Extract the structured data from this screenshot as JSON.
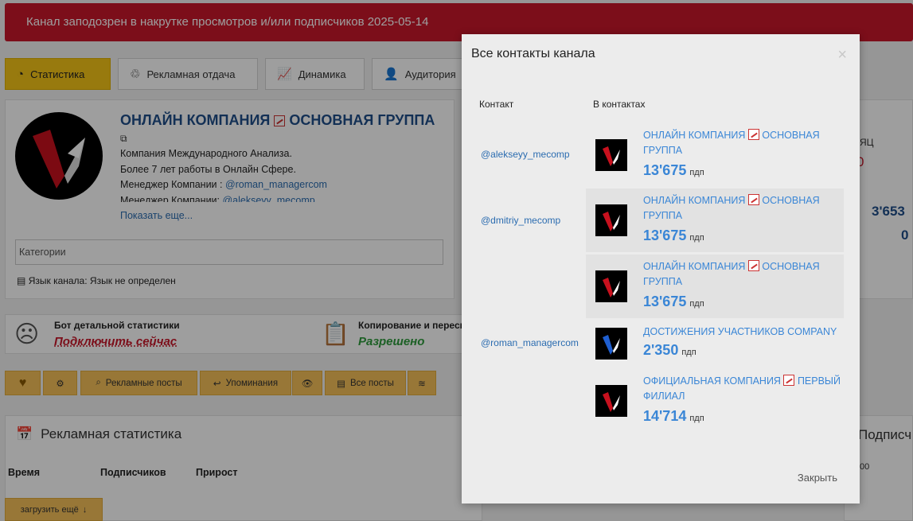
{
  "alert": {
    "text": "Канал заподозрен в накрутке просмотров и/или подписчиков 2025-05-14"
  },
  "tabs": [
    {
      "label": "Статистика"
    },
    {
      "label": "Рекламная отдача"
    },
    {
      "label": "Динамика"
    },
    {
      "label": "Аудитория"
    }
  ],
  "channel": {
    "title": "ОНЛАЙН КОМПАНИЯ",
    "title_part2": "ОСНОВНАЯ ГРУППА",
    "desc_line1": "Компания Международного Анализа.",
    "desc_line2": "Более 7 лет работы в Онлайн Сфере.",
    "desc_line3_label": "Менеджер Компании : ",
    "desc_line3_link": "@roman_managercom",
    "desc_line4_label": "Менеджер Компании: ",
    "desc_line4_link": "@alekseyy_mecomp",
    "more": "Показать еще...",
    "categories_placeholder": "Категории",
    "language": "Язык канала: Язык не определен"
  },
  "bot": {
    "title": "Бот детальной статистики",
    "link": "Подключить сейчас"
  },
  "copying": {
    "title": "Копирование и пересы",
    "value": "Разрешено"
  },
  "buttons": {
    "ads_posts": "Рекламные посты",
    "mentions": "Упоминания",
    "all_posts": "Все посты"
  },
  "ad_stats": {
    "title": "Рекламная статистика",
    "columns": [
      "Время",
      "Подписчиков",
      "Прирост"
    ],
    "load_more": "загрузить ещё"
  },
  "right_panel": {
    "month_label": "ЯЦ",
    "value_red": "0",
    "big_num": "3'653",
    "zero": "0",
    "subs_label": "Подписч",
    "axis": "00"
  },
  "modal": {
    "title": "Все контакты канала",
    "col_contact": "Контакт",
    "col_in_contacts": "В контактах",
    "close": "Закрыть",
    "contacts": [
      {
        "handle": "@alekseyy_mecomp"
      },
      {
        "handle": "@dmitriy_mecomp"
      },
      {
        "handle": "@roman_managercom"
      }
    ],
    "rows": [
      {
        "name1": "ОНЛАЙН КОМПАНИЯ",
        "name2": "ОСНОВНАЯ ГРУППА",
        "num": "13'675",
        "unit": "пдп"
      },
      {
        "name1": "ОНЛАЙН КОМПАНИЯ",
        "name2": "ОСНОВНАЯ ГРУППА",
        "num": "13'675",
        "unit": "пдп"
      },
      {
        "name1": "ОНЛАЙН КОМПАНИЯ",
        "name2": "ОСНОВНАЯ ГРУППА",
        "num": "13'675",
        "unit": "пдп"
      },
      {
        "name1": "ДОСТИЖЕНИЯ УЧАСТНИКОВ COMPANY",
        "name2": "",
        "num": "2'350",
        "unit": "пдп"
      },
      {
        "name1": "ОФИЦИАЛЬНАЯ КОМПАНИЯ",
        "name2": "ПЕРВЫЙ ФИЛИАЛ",
        "num": "14'714",
        "unit": "пдп"
      }
    ]
  },
  "colors": {
    "accent": "#f5c518",
    "alert": "#c8182b",
    "link": "#3a86d6"
  }
}
